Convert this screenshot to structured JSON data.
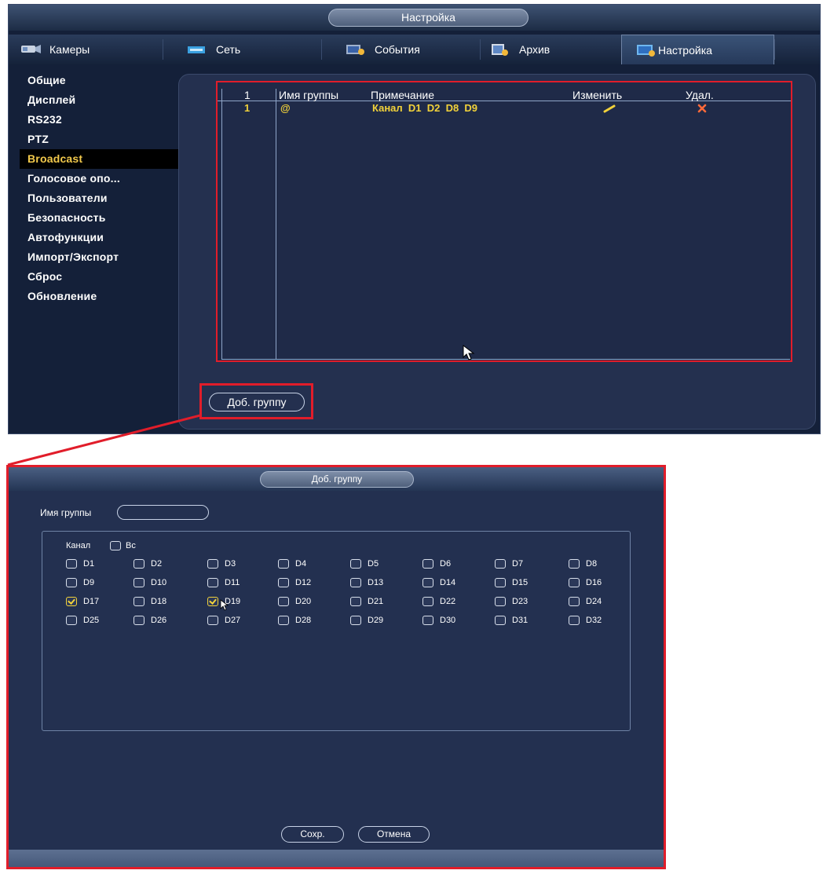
{
  "settings_window": {
    "title": "Настройка",
    "tabs": [
      {
        "label": "Камеры",
        "icon": "camera-icon"
      },
      {
        "label": "Сеть",
        "icon": "network-icon"
      },
      {
        "label": "События",
        "icon": "events-icon"
      },
      {
        "label": "Архив",
        "icon": "archive-icon"
      },
      {
        "label": "Настройка",
        "icon": "settings-icon",
        "active": true
      }
    ],
    "menu": [
      "Общие",
      "Дисплей",
      "RS232",
      "PTZ",
      "Broadcast",
      "Голосовое опо...",
      "Пользователи",
      "Безопасность",
      "Автофункции",
      "Импорт/Экспорт",
      "Сброс",
      "Обновление"
    ],
    "menu_active": "Broadcast",
    "table": {
      "headers": [
        "1",
        "Имя группы",
        "Примечание",
        "Изменить",
        "Удал."
      ],
      "rows": [
        {
          "num": "1",
          "name": "@",
          "note": "Канал  D1  D2  D8  D9"
        }
      ]
    },
    "add_group_button": "Доб. группу"
  },
  "dialog": {
    "title": "Доб. группу",
    "group_name_label": "Имя группы",
    "group_name_value": "",
    "channel_label": "Канал",
    "all_label": "Вс",
    "channels": [
      [
        "D1",
        "D2",
        "D3",
        "D4",
        "D5",
        "D6",
        "D7",
        "D8"
      ],
      [
        "D9",
        "D10",
        "D11",
        "D12",
        "D13",
        "D14",
        "D15",
        "D16"
      ],
      [
        "D17",
        "D18",
        "D19",
        "D20",
        "D21",
        "D22",
        "D23",
        "D24"
      ],
      [
        "D25",
        "D26",
        "D27",
        "D28",
        "D29",
        "D30",
        "D31",
        "D32"
      ]
    ],
    "checked": [
      "D17",
      "D19"
    ],
    "save_button": "Сохр.",
    "cancel_button": "Отмена"
  },
  "colors": {
    "highlight_red": "#e11d2a",
    "accent_yellow": "#f2d23a",
    "panel_bg": "#233050"
  }
}
